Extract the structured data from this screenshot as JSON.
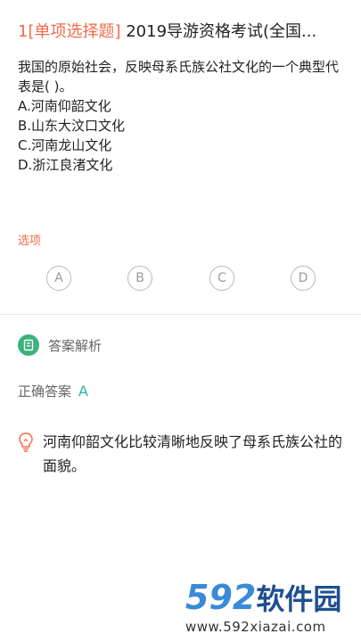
{
  "header": {
    "number": "1",
    "type": "[单项选择题]",
    "title": " 2019导游资格考试(全国..."
  },
  "question": {
    "text": "我国的原始社会，反映母系氏族公社文化的一个典型代表是( )。",
    "options": [
      "A.河南仰韶文化",
      "B.山东大汶口文化",
      "C.河南龙山文化",
      "D.浙江良渚文化"
    ]
  },
  "options_section": {
    "label": "选项",
    "choices": [
      "A",
      "B",
      "C",
      "D"
    ]
  },
  "analysis": {
    "label": "答案解析",
    "correct_label": "正确答案",
    "correct_value": "A",
    "explanation": "河南仰韶文化比较清晰地反映了母系氏族公社的面貌。"
  },
  "watermark": {
    "brand_digits": "592",
    "brand_cn": "软件园",
    "url": "www.592xiazai.com"
  },
  "colors": {
    "accent": "#f26b4a",
    "analysis_badge": "#3bb27a",
    "correct_answer": "#2bb3a0",
    "choice_border": "#b8b8b8"
  }
}
